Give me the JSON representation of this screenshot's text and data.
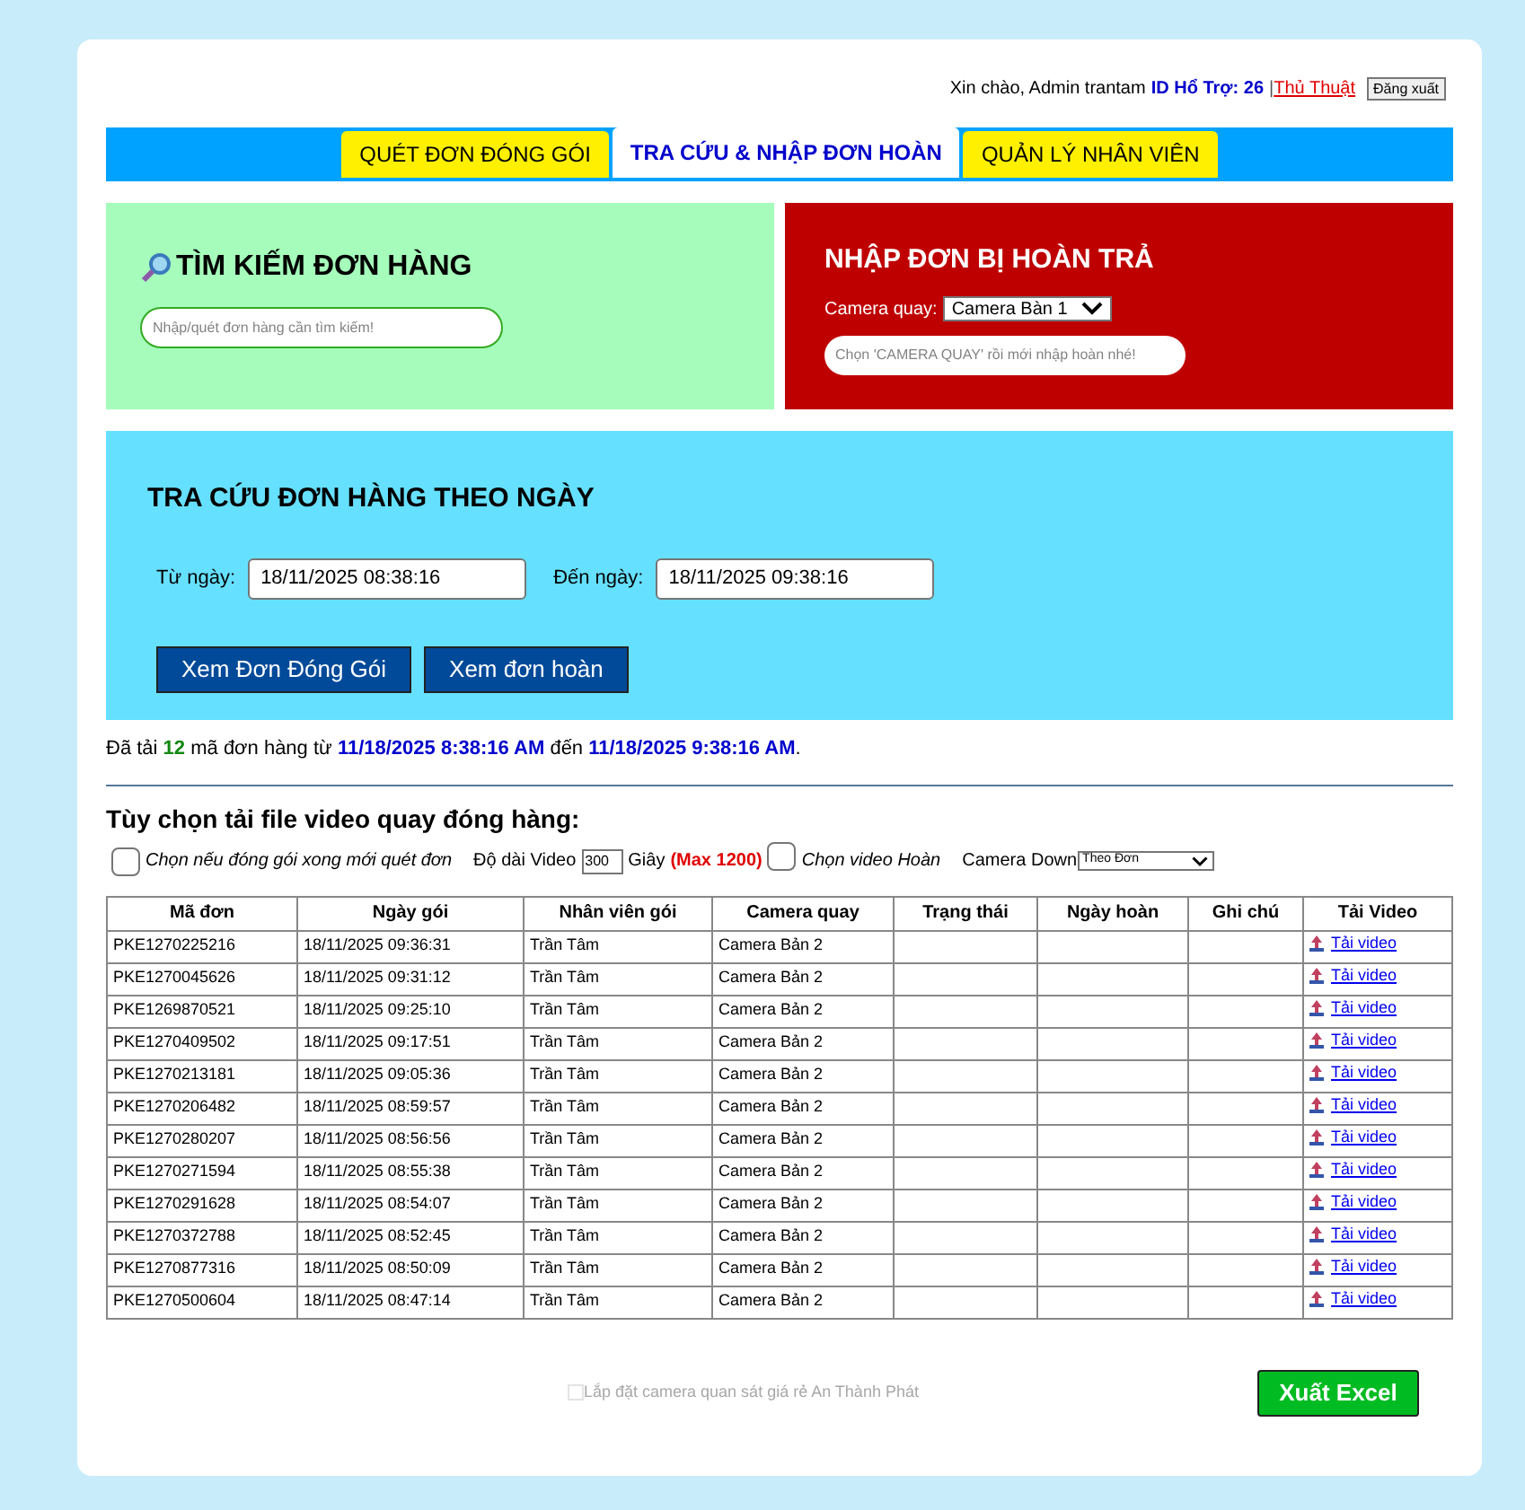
{
  "header": {
    "greeting": "Xin chào, Admin trantam",
    "support_id": "ID Hổ Trợ: 26",
    "separator": "|",
    "tips_link": "Thủ Thuật",
    "logout_button": "Đăng xuất"
  },
  "tabs": [
    {
      "label": "QUÉT ĐƠN ĐÓNG GÓI",
      "selected": false
    },
    {
      "label": "TRA CỨU & NHẬP ĐƠN HOÀN",
      "selected": true
    },
    {
      "label": "QUẢN LÝ NHÂN VIÊN",
      "selected": false
    }
  ],
  "search_panel": {
    "title": "TÌM KIẾM ĐƠN HÀNG",
    "placeholder": "Nhập/quét đơn hàng cần tìm kiếm!"
  },
  "return_panel": {
    "title": "NHẬP ĐƠN BỊ HOÀN TRẢ",
    "camera_label": "Camera quay:",
    "camera_value": "Camera Bàn 1",
    "placeholder": "Chọn 'CAMERA QUAY' rồi mới nhập hoàn nhé!"
  },
  "date_panel": {
    "title": "TRA CỨU ĐƠN HÀNG THEO NGÀY",
    "from_label": "Từ ngày:",
    "from_value": "18/11/2025 08:38:16",
    "to_label": "Đến ngày:",
    "to_value": "18/11/2025 09:38:16",
    "buttons": [
      "Xem Đơn Đóng Gói",
      "Xem đơn hoàn"
    ]
  },
  "summary": [
    {
      "kind": "plain",
      "text": "Đã tải "
    },
    {
      "kind": "count",
      "text": "12"
    },
    {
      "kind": "plain",
      "text": " mã đơn hàng từ "
    },
    {
      "kind": "date",
      "text": "11/18/2025 8:38:16 AM"
    },
    {
      "kind": "plain",
      "text": " đến "
    },
    {
      "kind": "date",
      "text": "11/18/2025 9:38:16 AM"
    },
    {
      "kind": "plain",
      "text": "."
    }
  ],
  "video_options": {
    "title": "Tùy chọn tải file video quay đóng hàng:",
    "pack_checkbox": {
      "label": "Chọn nếu đóng gói xong mới quét đơn",
      "checked": false
    },
    "length_label": "Độ dài Video",
    "length_value": "300",
    "unit": "Giây",
    "max_note": "(Max 1200)",
    "return_checkbox": {
      "label": "Chọn video Hoàn",
      "checked": false
    },
    "camera_label": "Camera Down",
    "camera_value": "Theo Đơn"
  },
  "table": {
    "columns": [
      "Mã đơn",
      "Ngày gói",
      "Nhân viên gói",
      "Camera quay",
      "Trạng thái",
      "Ngày hoàn",
      "Ghi chú",
      "Tải Video"
    ],
    "rows": [
      [
        "PKE1270225216",
        "18/11/2025 09:36:31",
        "Trần Tâm",
        "Camera Bản 2",
        "Tải video"
      ],
      [
        "PKE1270045626",
        "18/11/2025 09:31:12",
        "Trần Tâm",
        "Camera Bản 2",
        "Tải video"
      ],
      [
        "PKE1269870521",
        "18/11/2025 09:25:10",
        "Trần Tâm",
        "Camera Bản 2",
        "Tải video"
      ],
      [
        "PKE1270409502",
        "18/11/2025 09:17:51",
        "Trần Tâm",
        "Camera Bản 2",
        "Tải video"
      ],
      [
        "PKE1270213181",
        "18/11/2025 09:05:36",
        "Trần Tâm",
        "Camera Bản 2",
        "Tải video"
      ],
      [
        "PKE1270206482",
        "18/11/2025 08:59:57",
        "Trần Tâm",
        "Camera Bản 2",
        "Tải video"
      ],
      [
        "PKE1270280207",
        "18/11/2025 08:56:56",
        "Trần Tâm",
        "Camera Bản 2",
        "Tải video"
      ],
      [
        "PKE1270271594",
        "18/11/2025 08:55:38",
        "Trần Tâm",
        "Camera Bản 2",
        "Tải video"
      ],
      [
        "PKE1270291628",
        "18/11/2025 08:54:07",
        "Trần Tâm",
        "Camera Bản 2",
        "Tải video"
      ],
      [
        "PKE1270372788",
        "18/11/2025 08:52:45",
        "Trần Tâm",
        "Camera Bản 2",
        "Tải video"
      ],
      [
        "PKE1270877316",
        "18/11/2025 08:50:09",
        "Trần Tâm",
        "Camera Bản 2",
        "Tải video"
      ],
      [
        "PKE1270500604",
        "18/11/2025 08:47:14",
        "Trần Tâm",
        "Camera Bản 2",
        "Tải video"
      ]
    ]
  },
  "footer": {
    "image_alt": "Lắp đặt camera quan sát giá rẻ An Thành Phát",
    "export_button": "Xuất Excel"
  }
}
